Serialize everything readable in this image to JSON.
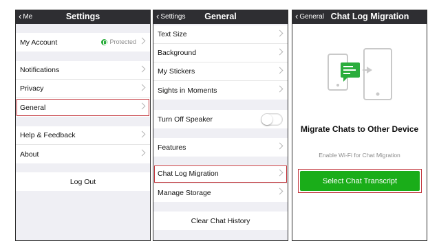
{
  "settings": {
    "back": "Me",
    "title": "Settings",
    "my_account": "My Account",
    "protected": "Protected",
    "notifications": "Notifications",
    "privacy": "Privacy",
    "general": "General",
    "help": "Help & Feedback",
    "about": "About",
    "logout": "Log Out"
  },
  "general": {
    "back": "Settings",
    "title": "General",
    "text_size": "Text Size",
    "background": "Background",
    "stickers": "My Stickers",
    "sights": "Sights in Moments",
    "speaker": "Turn Off Speaker",
    "features": "Features",
    "chat_log": "Chat Log Migration",
    "storage": "Manage Storage",
    "clear": "Clear Chat History"
  },
  "migration": {
    "back": "General",
    "title": "Chat Log Migration",
    "heading": "Migrate Chats to Other Device",
    "subtitle": "Enable Wi-Fi for Chat Migration",
    "button": "Select Chat Transcript"
  },
  "colors": {
    "accent_green": "#1aad19",
    "highlight_red": "#c2333a",
    "navbar": "#2e2e32"
  },
  "state": {
    "speaker_toggle_on": false
  }
}
